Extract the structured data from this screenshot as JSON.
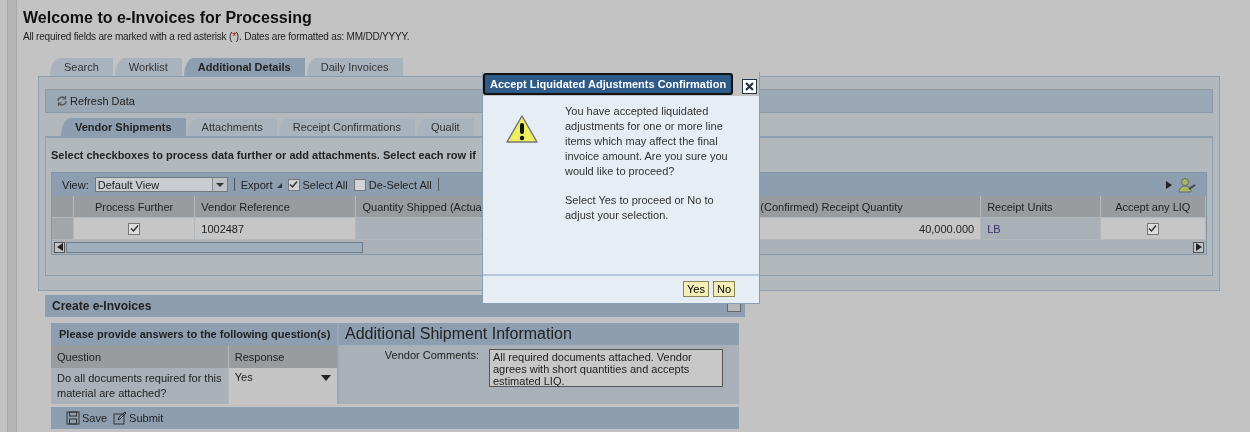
{
  "page": {
    "title": "Welcome to e-Invoices for Processing",
    "note_before": "All required fields are marked with a red asterisk (",
    "note_mark": "*",
    "note_after": "). Dates are formatted as: MM/DD/YYYY."
  },
  "tabs": [
    {
      "label": "Search",
      "selected": false
    },
    {
      "label": "Worklist",
      "selected": false
    },
    {
      "label": "Additional Details",
      "selected": true
    },
    {
      "label": "Daily Invoices",
      "selected": false
    }
  ],
  "refresh": {
    "label": "Refresh Data"
  },
  "subtabs": [
    {
      "label": "Vendor Shipments",
      "selected": true
    },
    {
      "label": "Attachments",
      "selected": false
    },
    {
      "label": "Receipt Confirmations",
      "selected": false
    },
    {
      "label": "Qualit",
      "selected": false
    }
  ],
  "instruction": "Select checkboxes to process data further or add attachments. Select each row if",
  "toolbar": {
    "view_label": "View:",
    "view_value": "Default View",
    "export": "Export",
    "select_all": "Select All",
    "deselect_all": "De-Select All"
  },
  "table": {
    "columns": [
      "Process Further",
      "Vendor Reference",
      "Quantity Shipped (Actua",
      "(Confirmed) Receipt Quantity",
      "Receipt Units",
      "Accept any LIQ"
    ],
    "rows": [
      {
        "process_further": true,
        "vendor_reference": "1002487",
        "receipt_quantity": "40,000.000",
        "receipt_units": "LB",
        "accept_liq": true
      }
    ]
  },
  "create": {
    "title": "Create e-Invoices",
    "questions_title": "Please provide answers to the following question(s)",
    "columns": [
      "Question",
      "Response"
    ],
    "questions": [
      {
        "question": "Do all documents required for this material are attached?",
        "response": "Yes"
      }
    ],
    "info_title": "Additional Shipment Information",
    "comments_label": "Vendor Comments:",
    "comments": "All required documents attached. Vendor agrees with short quantities and accepts estimated LIQ.",
    "actions": [
      "Save",
      "Submit"
    ]
  },
  "dialog": {
    "title": "Accept Liquidated Adjustments Confirmation",
    "paragraphs": [
      "You have accepted liquidated adjustments for one or more line items which may affect the final invoice amount. Are you sure you would like to proceed?",
      "Select Yes to proceed or No to adjust your selection."
    ],
    "buttons": [
      "Yes",
      "No"
    ]
  }
}
